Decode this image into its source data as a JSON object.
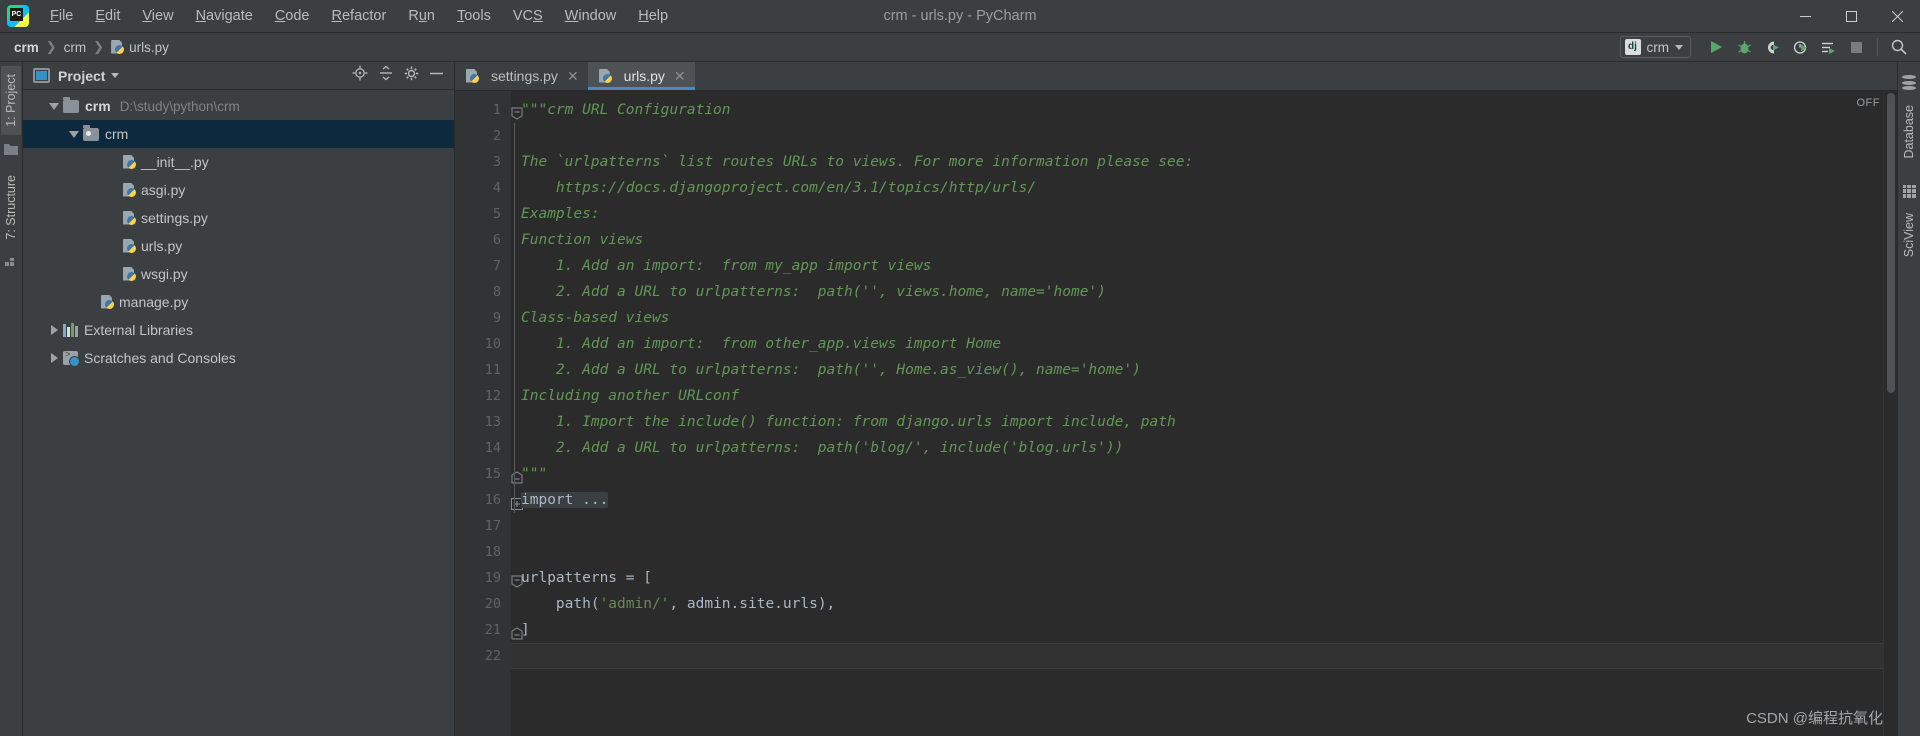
{
  "window": {
    "title": "crm - urls.py - PyCharm",
    "logo_label": "PC",
    "minimize": "—",
    "maximize": "▢",
    "close": "✕"
  },
  "menu": [
    {
      "label": "File",
      "mnemonic": "F"
    },
    {
      "label": "Edit",
      "mnemonic": "E"
    },
    {
      "label": "View",
      "mnemonic": "V"
    },
    {
      "label": "Navigate",
      "mnemonic": "N"
    },
    {
      "label": "Code",
      "mnemonic": "C"
    },
    {
      "label": "Refactor",
      "mnemonic": "R"
    },
    {
      "label": "Run",
      "mnemonic": "u"
    },
    {
      "label": "Tools",
      "mnemonic": "T"
    },
    {
      "label": "VCS",
      "mnemonic": "S"
    },
    {
      "label": "Window",
      "mnemonic": "W"
    },
    {
      "label": "Help",
      "mnemonic": "H"
    }
  ],
  "breadcrumb": {
    "items": [
      "crm",
      "crm",
      "urls.py"
    ],
    "separator": "❯"
  },
  "toolbar": {
    "run_config": {
      "icon_label": "dj",
      "name": "crm"
    },
    "buttons": [
      {
        "name": "run-button",
        "title": "Run"
      },
      {
        "name": "debug-button",
        "title": "Debug"
      },
      {
        "name": "run-with-coverage-button",
        "title": "Run with Coverage"
      },
      {
        "name": "profile-button",
        "title": "Profile"
      },
      {
        "name": "run-console-button",
        "title": "Run with Console"
      },
      {
        "name": "stop-button",
        "title": "Stop"
      },
      {
        "name": "search-everywhere-button",
        "title": "Search Everywhere"
      }
    ]
  },
  "left_strip": {
    "project_tab": "1: Project",
    "structure_tab": "7: Structure"
  },
  "project_panel": {
    "title": "Project",
    "tree": [
      {
        "indent": 0,
        "twisty": "down",
        "icon": "folder",
        "label": "crm",
        "bold": true,
        "path": "D:\\study\\python\\crm",
        "selected": false
      },
      {
        "indent": 1,
        "twisty": "down",
        "icon": "folder-module",
        "label": "crm",
        "bold": false,
        "path": "",
        "selected": true
      },
      {
        "indent": 2,
        "twisty": "none",
        "icon": "python-file",
        "label": "__init__.py",
        "bold": false,
        "path": "",
        "selected": false
      },
      {
        "indent": 2,
        "twisty": "none",
        "icon": "python-file",
        "label": "asgi.py",
        "bold": false,
        "path": "",
        "selected": false
      },
      {
        "indent": 2,
        "twisty": "none",
        "icon": "python-file",
        "label": "settings.py",
        "bold": false,
        "path": "",
        "selected": false
      },
      {
        "indent": 2,
        "twisty": "none",
        "icon": "python-file",
        "label": "urls.py",
        "bold": false,
        "path": "",
        "selected": false
      },
      {
        "indent": 2,
        "twisty": "none",
        "icon": "python-file",
        "label": "wsgi.py",
        "bold": false,
        "path": "",
        "selected": false
      },
      {
        "indent": 1,
        "twisty": "none",
        "icon": "python-file",
        "label": "manage.py",
        "bold": false,
        "path": "",
        "selected": false
      },
      {
        "indent": 0,
        "twisty": "right",
        "icon": "library",
        "label": "External Libraries",
        "bold": false,
        "path": "",
        "selected": false
      },
      {
        "indent": 0,
        "twisty": "right",
        "icon": "scratch",
        "label": "Scratches and Consoles",
        "bold": false,
        "path": "",
        "selected": false
      }
    ]
  },
  "editor": {
    "tabs": [
      {
        "label": "settings.py",
        "active": false,
        "close": "✕"
      },
      {
        "label": "urls.py",
        "active": true,
        "close": "✕"
      }
    ],
    "line_numbers": [
      "1",
      "2",
      "3",
      "4",
      "5",
      "6",
      "7",
      "8",
      "9",
      "10",
      "11",
      "12",
      "13",
      "14",
      "15",
      "16",
      "17",
      "18",
      "19",
      "20",
      "21",
      "22"
    ],
    "lines": [
      {
        "n": 1,
        "indent": 0,
        "fold": "start",
        "segments": [
          {
            "t": "\"\"\"crm URL Configuration",
            "c": "doc"
          }
        ]
      },
      {
        "n": 2,
        "indent": 0,
        "fold": "",
        "segments": []
      },
      {
        "n": 3,
        "indent": 0,
        "fold": "",
        "segments": [
          {
            "t": "The `urlpatterns` list routes URLs to views. For more information please see:",
            "c": "doc"
          }
        ]
      },
      {
        "n": 4,
        "indent": 0,
        "fold": "",
        "segments": [
          {
            "t": "    https://docs.djangoproject.com/en/3.1/topics/http/urls/",
            "c": "doc"
          }
        ]
      },
      {
        "n": 5,
        "indent": 0,
        "fold": "",
        "segments": [
          {
            "t": "Examples:",
            "c": "doc"
          }
        ]
      },
      {
        "n": 6,
        "indent": 0,
        "fold": "",
        "segments": [
          {
            "t": "Function views",
            "c": "doc"
          }
        ]
      },
      {
        "n": 7,
        "indent": 0,
        "fold": "",
        "segments": [
          {
            "t": "    1. Add an import:  from my_app import views",
            "c": "doc"
          }
        ]
      },
      {
        "n": 8,
        "indent": 0,
        "fold": "",
        "segments": [
          {
            "t": "    2. Add a URL to urlpatterns:  path('', views.home, name='home')",
            "c": "doc"
          }
        ]
      },
      {
        "n": 9,
        "indent": 0,
        "fold": "",
        "segments": [
          {
            "t": "Class-based views",
            "c": "doc"
          }
        ]
      },
      {
        "n": 10,
        "indent": 0,
        "fold": "",
        "segments": [
          {
            "t": "    1. Add an import:  from other_app.views import Home",
            "c": "doc"
          }
        ]
      },
      {
        "n": 11,
        "indent": 0,
        "fold": "",
        "segments": [
          {
            "t": "    2. Add a URL to urlpatterns:  path('', Home.as_view(), name='home')",
            "c": "doc"
          }
        ]
      },
      {
        "n": 12,
        "indent": 0,
        "fold": "",
        "segments": [
          {
            "t": "Including another URLconf",
            "c": "doc"
          }
        ]
      },
      {
        "n": 13,
        "indent": 0,
        "fold": "",
        "segments": [
          {
            "t": "    1. Import the include() function: from django.urls import include, path",
            "c": "doc"
          }
        ]
      },
      {
        "n": 14,
        "indent": 0,
        "fold": "",
        "segments": [
          {
            "t": "    2. Add a URL to urlpatterns:  path('blog/', include('blog.urls'))",
            "c": "doc"
          }
        ]
      },
      {
        "n": 15,
        "indent": 0,
        "fold": "end",
        "segments": [
          {
            "t": "\"\"\"",
            "c": "doc"
          }
        ]
      },
      {
        "n": 16,
        "indent": 0,
        "fold": "collapsed",
        "segments": [
          {
            "t": "import ...",
            "c": "folded"
          }
        ]
      },
      {
        "n": 17,
        "indent": 0,
        "fold": "",
        "segments": []
      },
      {
        "n": 18,
        "indent": 0,
        "fold": "",
        "segments": []
      },
      {
        "n": 19,
        "indent": 0,
        "fold": "start",
        "segments": [
          {
            "t": "urlpatterns = [",
            "c": "def"
          }
        ]
      },
      {
        "n": 20,
        "indent": 0,
        "fold": "",
        "segments": [
          {
            "t": "    path(",
            "c": "def"
          },
          {
            "t": "'admin/'",
            "c": "str"
          },
          {
            "t": ", admin.site.urls),",
            "c": "def"
          }
        ]
      },
      {
        "n": 21,
        "indent": 0,
        "fold": "end",
        "segments": [
          {
            "t": "]",
            "c": "def"
          }
        ]
      },
      {
        "n": 22,
        "indent": 0,
        "fold": "",
        "segments": []
      }
    ],
    "caret_line": 22
  },
  "right_strip": {
    "off_label": "OFF",
    "database_tab": "Database",
    "sciview_tab": "SciView"
  },
  "watermark": "CSDN @编程抗氧化",
  "colors": {
    "accent": "#4a88c7",
    "selection": "#0d293e",
    "editor_bg": "#2b2b2b",
    "panel_bg": "#3c3f41",
    "gutter_bg": "#313335",
    "doc_green": "#629755",
    "string_green": "#6a8759",
    "run_green": "#59a869"
  }
}
